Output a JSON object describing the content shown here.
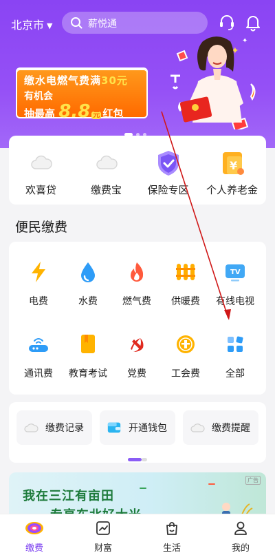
{
  "header": {
    "city": "北京市",
    "search_placeholder": "薪悦通"
  },
  "banner": {
    "line1": "缴水电燃气费满",
    "line1_amount": "30元",
    "line2": "有机会",
    "line3_prefix": "抽最高",
    "line3_amount": "8.8",
    "line3_unit": "元",
    "line3_suffix": "红包"
  },
  "quick_actions": [
    {
      "label": "欢喜贷",
      "icon": "cloud-placeholder-icon"
    },
    {
      "label": "缴费宝",
      "icon": "cloud-placeholder-icon"
    },
    {
      "label": "保险专区",
      "icon": "shield-check-icon"
    },
    {
      "label": "个人养老金",
      "icon": "yuan-coin-icon"
    }
  ],
  "section_title": "便民缴费",
  "payments": [
    {
      "label": "电费",
      "icon": "lightning-icon"
    },
    {
      "label": "水费",
      "icon": "water-drop-icon"
    },
    {
      "label": "燃气费",
      "icon": "flame-icon"
    },
    {
      "label": "供暖费",
      "icon": "radiator-icon"
    },
    {
      "label": "有线电视",
      "icon": "tv-icon"
    },
    {
      "label": "通讯费",
      "icon": "router-icon"
    },
    {
      "label": "教育考试",
      "icon": "book-icon"
    },
    {
      "label": "党费",
      "icon": "party-emblem-icon"
    },
    {
      "label": "工会费",
      "icon": "union-badge-icon"
    },
    {
      "label": "全部",
      "icon": "grid-all-icon"
    }
  ],
  "services": [
    {
      "label": "缴费记录",
      "icon": "cloud-placeholder-icon"
    },
    {
      "label": "开通钱包",
      "icon": "wallet-icon"
    },
    {
      "label": "缴费提醒",
      "icon": "cloud-placeholder-icon"
    }
  ],
  "ad": {
    "line1": "我在三江有亩田",
    "line2": "专享东北好大米",
    "badge": "广告"
  },
  "tabs": [
    {
      "label": "缴费",
      "icon": "pay-logo-icon",
      "active": true
    },
    {
      "label": "财富",
      "icon": "chart-icon",
      "active": false
    },
    {
      "label": "生活",
      "icon": "shopping-bag-icon",
      "active": false
    },
    {
      "label": "我的",
      "icon": "person-icon",
      "active": false
    }
  ],
  "colors": {
    "brand_purple": "#8a44f3",
    "active_tab": "#7a3df0",
    "banner_orange": "#ff7a0a",
    "highlight_yellow": "#ffe34a"
  }
}
